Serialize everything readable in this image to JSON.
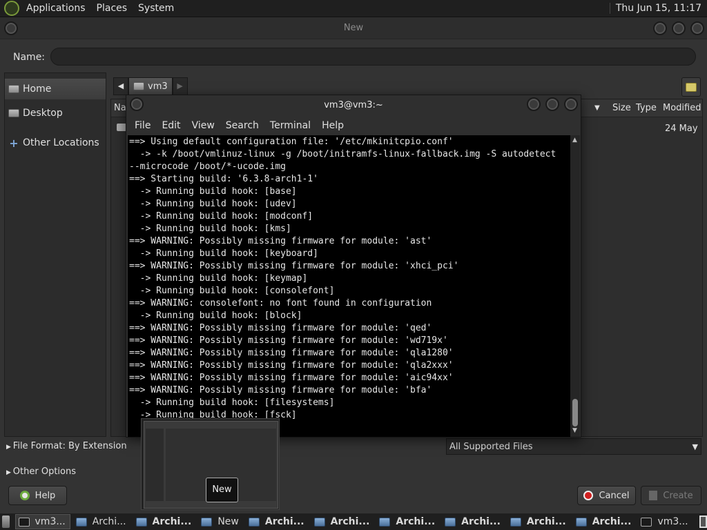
{
  "top_panel": {
    "menus": [
      "Applications",
      "Places",
      "System"
    ],
    "clock": "Thu Jun 15, 11:17"
  },
  "dialog": {
    "title": "New",
    "name_label": "Name:",
    "name_value": "",
    "places": [
      {
        "label": "Home",
        "icon": "home-folder-icon"
      },
      {
        "label": "Desktop",
        "icon": "desktop-folder-icon"
      },
      {
        "label": "Other Locations",
        "icon": "plus-icon"
      }
    ],
    "path_bar": {
      "current": "vm3"
    },
    "columns": {
      "name": "Na",
      "size": "Size",
      "type": "Type",
      "modified": "Modified"
    },
    "rows": [
      {
        "modified": "24 May"
      }
    ],
    "file_format": "File Format: By Extension",
    "filter": "All Supported Files",
    "other_options": "Other Options",
    "buttons": {
      "help": "Help",
      "cancel": "Cancel",
      "create": "Create"
    }
  },
  "terminal": {
    "title": "vm3@vm3:~",
    "menus": [
      "File",
      "Edit",
      "View",
      "Search",
      "Terminal",
      "Help"
    ],
    "lines": [
      "==> Using default configuration file: '/etc/mkinitcpio.conf'",
      "  -> -k /boot/vmlinuz-linux -g /boot/initramfs-linux-fallback.img -S autodetect",
      "--microcode /boot/*-ucode.img",
      "==> Starting build: '6.3.8-arch1-1'",
      "  -> Running build hook: [base]",
      "  -> Running build hook: [udev]",
      "  -> Running build hook: [modconf]",
      "  -> Running build hook: [kms]",
      "==> WARNING: Possibly missing firmware for module: 'ast'",
      "  -> Running build hook: [keyboard]",
      "==> WARNING: Possibly missing firmware for module: 'xhci_pci'",
      "  -> Running build hook: [keymap]",
      "  -> Running build hook: [consolefont]",
      "==> WARNING: consolefont: no font found in configuration",
      "  -> Running build hook: [block]",
      "==> WARNING: Possibly missing firmware for module: 'qed'",
      "==> WARNING: Possibly missing firmware for module: 'wd719x'",
      "==> WARNING: Possibly missing firmware for module: 'qla1280'",
      "==> WARNING: Possibly missing firmware for module: 'qla2xxx'",
      "==> WARNING: Possibly missing firmware for module: 'aic94xx'",
      "==> WARNING: Possibly missing firmware for module: 'bfa'",
      "  -> Running build hook: [filesystems]",
      "  -> Running build hook: [fsck]"
    ]
  },
  "preview_tooltip": "New",
  "taskbar": {
    "tasks": [
      {
        "label": "vm3...",
        "icon": "terminal",
        "active": true,
        "bold": false
      },
      {
        "label": "Archi...",
        "icon": "app",
        "active": false,
        "bold": false
      },
      {
        "label": "Archi...",
        "icon": "app",
        "active": false,
        "bold": true
      },
      {
        "label": "New",
        "icon": "app",
        "active": false,
        "bold": false
      },
      {
        "label": "Archi...",
        "icon": "app",
        "active": false,
        "bold": true
      },
      {
        "label": "Archi...",
        "icon": "app",
        "active": false,
        "bold": true
      },
      {
        "label": "Archi...",
        "icon": "app",
        "active": false,
        "bold": true
      },
      {
        "label": "Archi...",
        "icon": "app",
        "active": false,
        "bold": true
      },
      {
        "label": "Archi...",
        "icon": "app",
        "active": false,
        "bold": true
      },
      {
        "label": "Archi...",
        "icon": "app",
        "active": false,
        "bold": true
      },
      {
        "label": "vm3...",
        "icon": "terminal",
        "active": false,
        "bold": false
      }
    ]
  }
}
